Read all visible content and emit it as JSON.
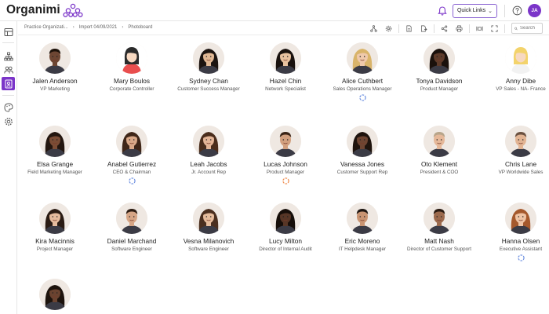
{
  "app": {
    "name": "Organimi"
  },
  "header": {
    "quick_links_label": "Quick Links",
    "user_initials": "JA",
    "colors": {
      "accent": "#7b35c9",
      "border_accent": "#8a63d2"
    }
  },
  "breadcrumb": [
    "Practice Organizati...",
    "Import 04/09/2021",
    "Photoboard"
  ],
  "toolbar": {
    "icons": [
      "hierarchy-icon",
      "settings-icon",
      "export-pdf-icon",
      "export-file-icon",
      "share-icon",
      "print-icon",
      "fit-width-icon",
      "expand-icon"
    ],
    "search_placeholder": "Search"
  },
  "sidebar": {
    "items": [
      "layout-icon",
      "org-chart-icon",
      "people-icon",
      "photoboard-icon",
      "palette-icon",
      "settings-icon"
    ],
    "active": "photoboard-icon"
  },
  "people": [
    {
      "name": "Jalen Anderson",
      "title": "VP Marketing",
      "photo": "man-dark"
    },
    {
      "name": "Mary Boulos",
      "title": "Corporate Controller",
      "photo": "placeholder-female"
    },
    {
      "name": "Sydney Chan",
      "title": "Customer Success Manager",
      "photo": "woman-asian"
    },
    {
      "name": "Hazel Chin",
      "title": "Network Specialist",
      "photo": "woman-asian-2"
    },
    {
      "name": "Alice Cuthbert",
      "title": "Sales Operations Manager",
      "photo": "woman-blonde",
      "indicator": "blue"
    },
    {
      "name": "Tonya Davidson",
      "title": "Product Manager",
      "photo": "woman-dark"
    },
    {
      "name": "Anny Dibe",
      "title": "VP Sales - NA- France",
      "photo": "placeholder-blonde"
    },
    {
      "name": "Elsa Grange",
      "title": "Field Marketing Manager",
      "photo": "woman-dark-2"
    },
    {
      "name": "Anabel Gutierrez",
      "title": "CEO & Chairman",
      "photo": "woman-brunette",
      "indicator": "blue"
    },
    {
      "name": "Leah Jacobs",
      "title": "Jr. Account Rep",
      "photo": "woman-brunette-2"
    },
    {
      "name": "Lucas Johnson",
      "title": "Product Manager",
      "photo": "man-brunette",
      "indicator": "orange"
    },
    {
      "name": "Vanessa Jones",
      "title": "Customer Support Rep",
      "photo": "woman-curly"
    },
    {
      "name": "Oto Klement",
      "title": "President & COO",
      "photo": "man-light"
    },
    {
      "name": "Chris Lane",
      "title": "VP Worldwide Sales",
      "photo": "man-light-2"
    },
    {
      "name": "Kira Macinnis",
      "title": "Project Manager",
      "photo": "woman-dark-hair"
    },
    {
      "name": "Daniel Marchand",
      "title": "Software Engineer",
      "photo": "man-brunette-2"
    },
    {
      "name": "Vesna Milanovich",
      "title": "Software Engineer",
      "photo": "woman-brunette-3"
    },
    {
      "name": "Lucy Milton",
      "title": "Director of Internal Audit",
      "photo": "woman-curly-2"
    },
    {
      "name": "Eric Moreno",
      "title": "IT Helpdesk Manager",
      "photo": "man-asian"
    },
    {
      "name": "Matt Nash",
      "title": "Director of Customer Support",
      "photo": "man-dark-2"
    },
    {
      "name": "Hanna Olsen",
      "title": "Executive Assistant",
      "photo": "woman-auburn",
      "indicator": "blue"
    },
    {
      "name": "",
      "title": "",
      "photo": "woman-dark-3"
    }
  ]
}
